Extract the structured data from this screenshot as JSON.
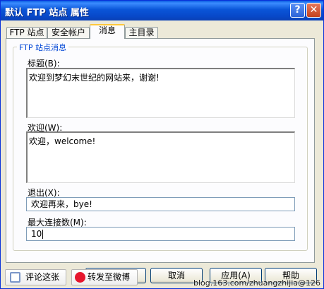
{
  "window": {
    "title": "默认 FTP 站点 属性",
    "help_glyph": "?",
    "close_glyph": "✕"
  },
  "tabs": [
    {
      "label": "FTP 站点"
    },
    {
      "label": "安全帐户"
    },
    {
      "label": "消息",
      "active": true
    },
    {
      "label": "主目录"
    }
  ],
  "group": {
    "title": "FTP 站点消息"
  },
  "fields": {
    "title_label": "标题(B):",
    "title_value": "欢迎到梦幻末世纪的网站来，谢谢!",
    "welcome_label": "欢迎(W):",
    "welcome_value": "欢迎，welcome!",
    "exit_label": "退出(X):",
    "exit_value": "欢迎再来，bye!",
    "maxconn_label": "最大连接数(M):",
    "maxconn_value": "10"
  },
  "buttons": {
    "cancel": "取消",
    "apply": "应用(A)",
    "help": "帮助"
  },
  "overlay": {
    "comment_label": "评论这张",
    "repost_label": "转发至微博",
    "watermark": "blog.163.com/zhuangzhijia@126"
  },
  "colors": {
    "titlebar": "#0a55d8",
    "group_title": "#0046d5",
    "active_tab_accent": "#ffc83c",
    "weibo_red": "#e6162d"
  }
}
